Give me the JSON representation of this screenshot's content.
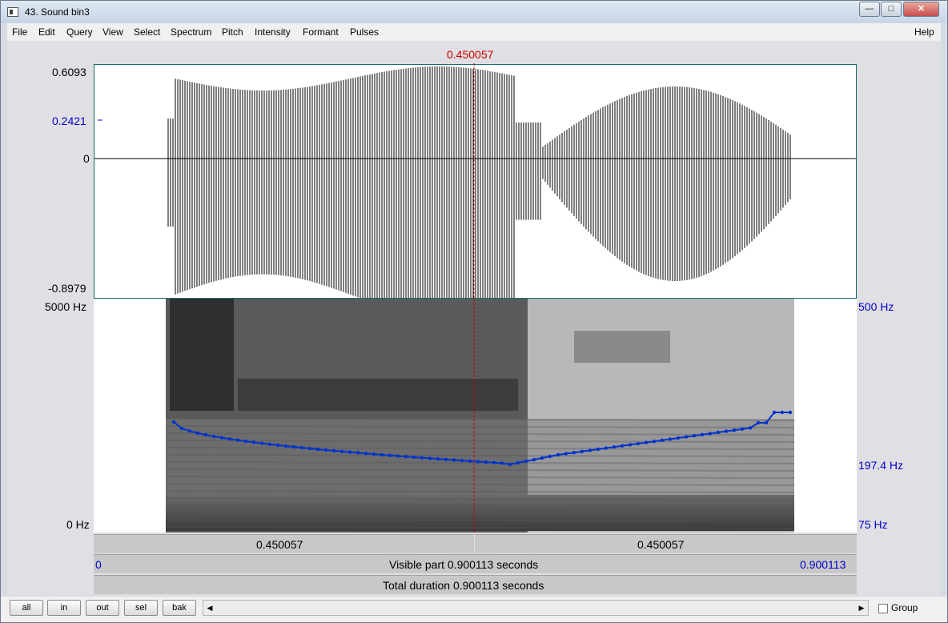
{
  "window": {
    "title": "43. Sound bin3",
    "buttons": {
      "minimize": "—",
      "maximize": "□",
      "close": "✕"
    }
  },
  "menu": [
    "File",
    "Edit",
    "Query",
    "View",
    "Select",
    "Spectrum",
    "Pitch",
    "Intensity",
    "Formant",
    "Pulses"
  ],
  "help": "Help",
  "cursor_time": "0.450057",
  "waveform": {
    "ymax": "0.6093",
    "cursor_amp": "0.2421",
    "zero": "0",
    "ymin": "-0.8979"
  },
  "spectrogram": {
    "fmax": "5000 Hz",
    "fmin": "0 Hz",
    "pitch_max": "500 Hz",
    "pitch_cursor": "197.4 Hz",
    "pitch_min": "75 Hz"
  },
  "bars": {
    "left_segment": "0.450057",
    "right_segment": "0.450057",
    "visible_start": "0",
    "visible_label": "Visible part 0.900113 seconds",
    "visible_end": "0.900113",
    "total_label": "Total duration 0.900113 seconds"
  },
  "nav_buttons": [
    "all",
    "in",
    "out",
    "sel",
    "bak"
  ],
  "scroll": {
    "left_arrow": "◀",
    "right_arrow": "▶"
  },
  "group_label": "Group",
  "colors": {
    "pitch": "#0033cc",
    "cursor": "#cc0000",
    "wave": "#000000"
  }
}
